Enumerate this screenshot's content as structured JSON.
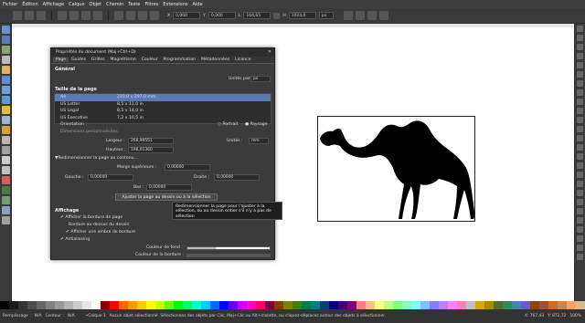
{
  "menu": [
    "Fichier",
    "Édition",
    "Affichage",
    "Calque",
    "Objet",
    "Chemin",
    "Texte",
    "Filtres",
    "Extensions",
    "Aide"
  ],
  "toolbar": {
    "x_label": "X",
    "x_value": "0,000",
    "y_label": "Y",
    "y_value": "0,000",
    "w_label": "L",
    "w_value": "164,65",
    "h_label": "H",
    "h_value": "1024,0",
    "units": "px",
    "zoom": "0"
  },
  "dialog": {
    "title": "Propriétés du document (Maj+Ctrl+D)",
    "close": "✕",
    "tabs": [
      "Page",
      "Guides",
      "Grilles",
      "Magnétisme",
      "Couleur",
      "Programmation",
      "Métadonnées",
      "Licence"
    ],
    "general": "Général",
    "default_units_label": "Unités par défaut :",
    "default_units": "px",
    "page_size": "Taille de la page",
    "sizes": [
      {
        "name": "A4",
        "dim": "210,0 x 297,0 mm"
      },
      {
        "name": "US Letter",
        "dim": "8,5 x 11,0 in"
      },
      {
        "name": "US Legal",
        "dim": "8,5 x 14,0 in"
      },
      {
        "name": "US Executive",
        "dim": "7,2 x 10,5 in"
      }
    ],
    "orientation_label": "Orientation :",
    "portrait": "Portrait",
    "landscape": "Paysage",
    "custom_dims": "Dimensions personnalisées",
    "width_label": "Largeur :",
    "width_value": "268,99551",
    "height_label": "Hauteur :",
    "height_value": "198,01360",
    "units_label": "Unités :",
    "units_value": "mm",
    "resize_expander": "▼Redimensionner la page au contenu...",
    "margin_top_label": "Marge supérieure :",
    "margin_top": "0,00000",
    "left_label": "Gauche :",
    "left": "0,00000",
    "right_label": "Droite :",
    "right": "0,00000",
    "bottom_label": "Bas :",
    "bottom": "0,00000",
    "fit_button": "Ajuster la page au dessin ou à la sélection",
    "display": "Affichage",
    "show_border": "Afficher la bordure de page",
    "border_on_top": "Bordure au-dessus du dessin",
    "show_shadow": "Afficher une ombre de bordure",
    "antialias": "Antialiasing",
    "bg_color_label": "Couleur de fond :",
    "border_color_label": "Couleur de la bordure :"
  },
  "tooltip": "Redimensionner la page pour l'ajuster à la sélection, ou au dessin entier s'il n'y a pas de sélection",
  "status": {
    "fill_label": "Remplissage :",
    "fill": "N/A",
    "stroke_label": "Contour :",
    "stroke": "N/A",
    "layer": "•Calque 1",
    "message": "Aucun objet sélectionné. Sélectionnez des objets par Clic, Maj+Clic ou Alt+molette, ou cliquez-déplacez autour des objets à sélectionner.",
    "x": "X: 767,43",
    "y": "Y: 872,72",
    "zoom": "100%"
  },
  "palette": [
    "#000000",
    "#1a1a1a",
    "#333333",
    "#4d4d4d",
    "#666666",
    "#808080",
    "#999999",
    "#b3b3b3",
    "#cccccc",
    "#e6e6e6",
    "#ffffff",
    "#800000",
    "#ff0000",
    "#ff6600",
    "#ff9900",
    "#ffcc00",
    "#ffff00",
    "#ccff00",
    "#66ff00",
    "#00ff00",
    "#00ff66",
    "#00ffcc",
    "#00ccff",
    "#0066ff",
    "#0000ff",
    "#6600ff",
    "#cc00ff",
    "#ff00cc",
    "#ff0066",
    "#800040",
    "#804000",
    "#808000",
    "#408000",
    "#008040",
    "#008080",
    "#004080",
    "#000080",
    "#400080",
    "#800080",
    "#ff8080",
    "#ffbf80",
    "#ffff80",
    "#bfff80",
    "#80ff80",
    "#80ffbf",
    "#80ffff",
    "#80bfff",
    "#8080ff",
    "#bf80ff",
    "#ff80ff",
    "#ff80bf",
    "#c0c0c0",
    "#d4aa00",
    "#aa8800",
    "#556b2f",
    "#2e8b57",
    "#4682b4",
    "#6a5acd",
    "#8b4513",
    "#a0522d",
    "#d2691e",
    "#cd853f",
    "#f4a460",
    "#deb887"
  ]
}
